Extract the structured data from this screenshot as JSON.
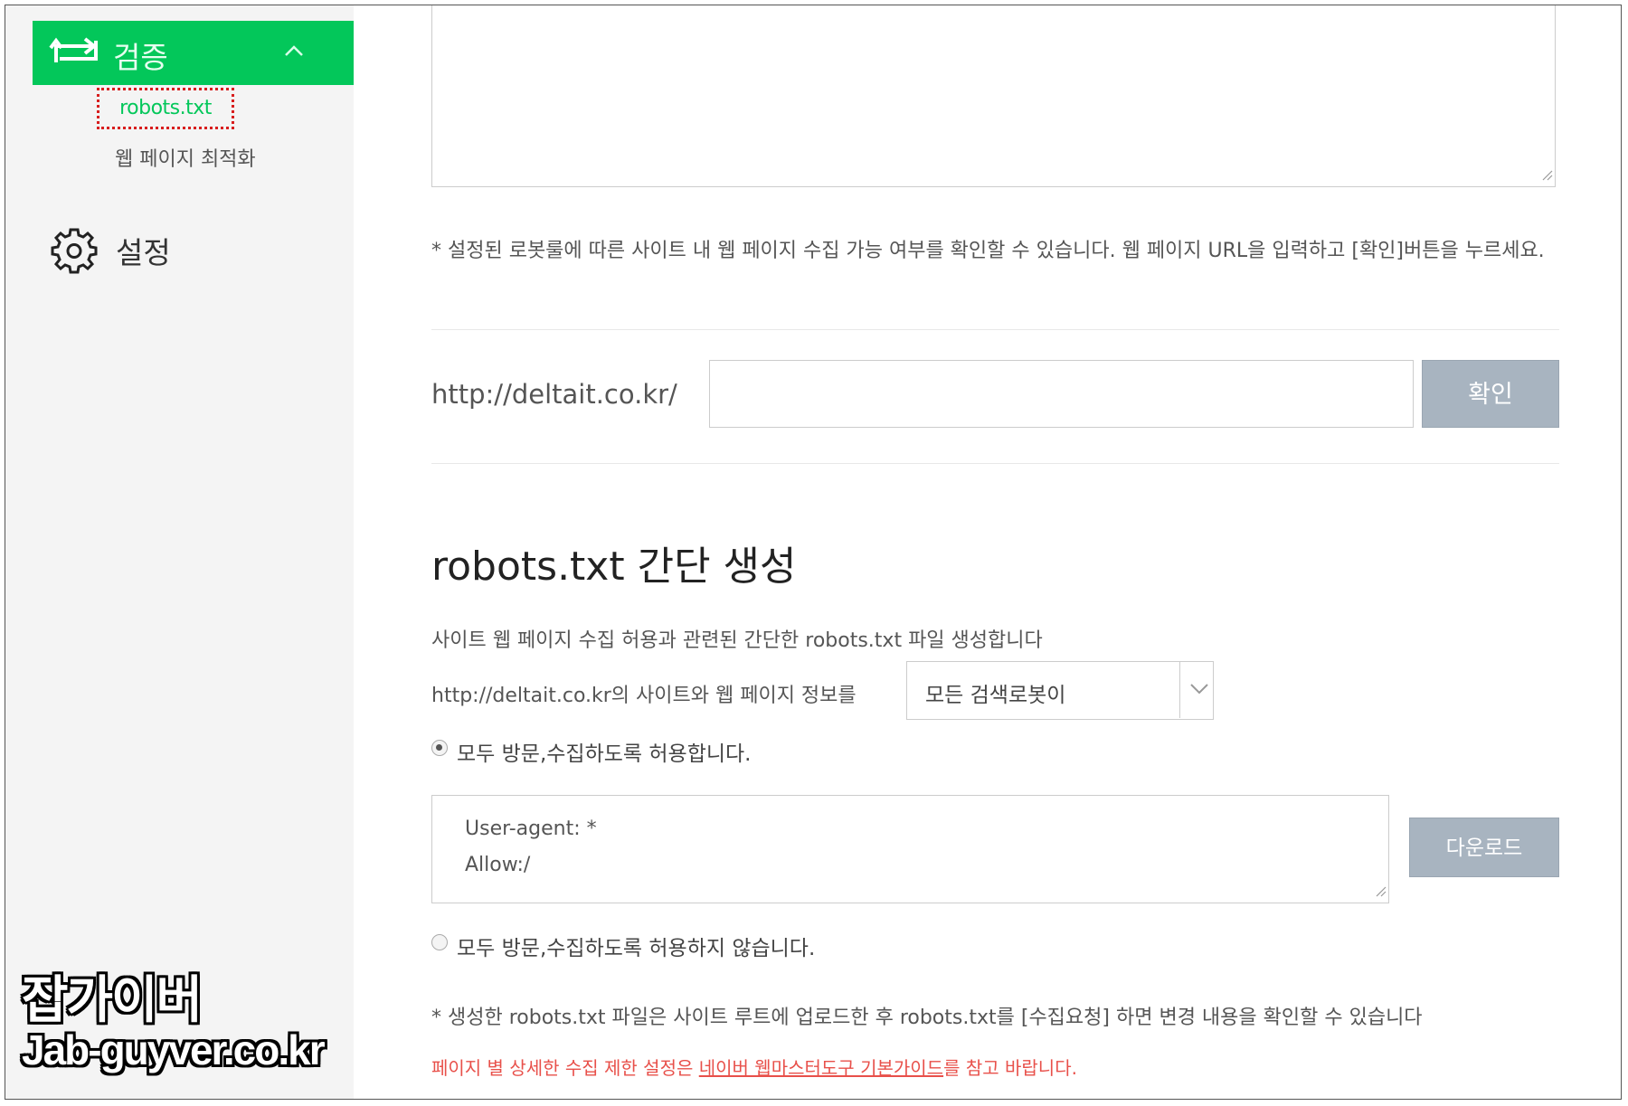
{
  "sidebar": {
    "active_menu_label": "검증",
    "active_menu_icon": "sync-arrows-icon",
    "submenu_selected": "robots.txt",
    "submenu_item": "웹 페이지 최적화",
    "settings_label": "설정",
    "settings_icon": "gear-icon",
    "accent_color": "#03c75a"
  },
  "check": {
    "description": "* 설정된 로봇룰에 따른 사이트 내 웹 페이지 수집 가능 여부를 확인할 수 있습니다. 웹 페이지 URL을 입력하고 [확인]버튼을 누르세요.",
    "url_prefix": "http://deltait.co.kr/",
    "url_value": "",
    "confirm_label": "확인"
  },
  "generator": {
    "title": "robots.txt 간단 생성",
    "description": "사이트 웹 페이지 수집 허용과 관련된 간단한 robots.txt 파일 생성합니다",
    "site_prefix": "http://deltait.co.kr의 사이트와 웹 페이지 정보를",
    "select_value": "모든 검색로봇이",
    "option_allow": "모두 방문,수집하도록 허용합니다.",
    "option_disallow": "모두 방문,수집하도록 허용하지 않습니다.",
    "selected_option": "allow",
    "rule_lines": [
      "User-agent: *",
      "Allow:/"
    ],
    "download_label": "다운로드",
    "note": "* 생성한 robots.txt 파일은 사이트 루트에 업로드한 후 robots.txt를 [수집요청] 하면 변경 내용을 확인할 수 있습니다",
    "guide_prefix": "페이지 별 상세한 수집 제한 설정은 ",
    "guide_link": "네이버 웹마스터도구 기본가이드",
    "guide_suffix": "를 참고 바랍니다.",
    "guide_color": "#e8504a"
  },
  "watermark": {
    "line1": "잡가이버",
    "line2": "Jab-guyver.co.kr"
  }
}
